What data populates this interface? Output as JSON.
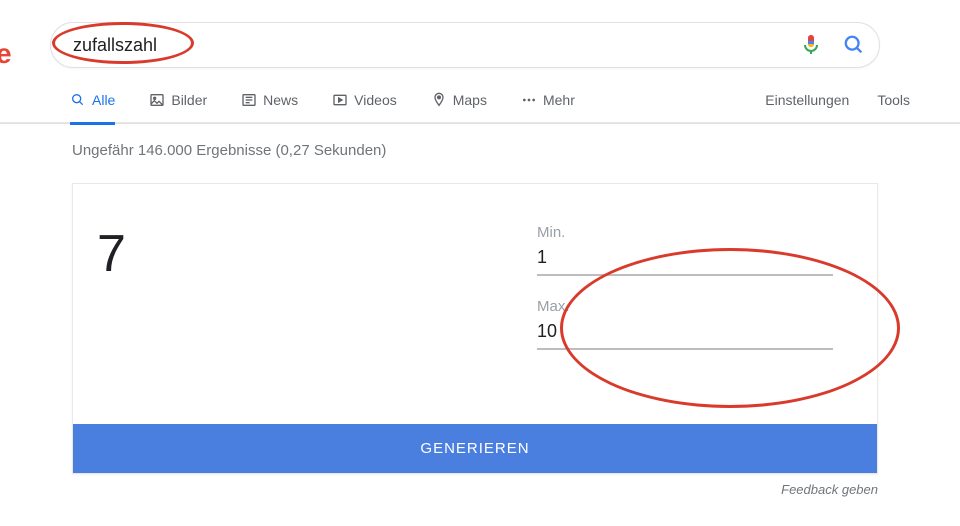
{
  "logo_fragment": "e",
  "search": {
    "query": "zufallszahl"
  },
  "tabs": {
    "all": "Alle",
    "images": "Bilder",
    "news": "News",
    "videos": "Videos",
    "maps": "Maps",
    "more": "Mehr",
    "settings": "Einstellungen",
    "tools": "Tools"
  },
  "result_stats": "Ungefähr 146.000 Ergebnisse (0,27 Sekunden)",
  "rng": {
    "result": "7",
    "min_label": "Min.",
    "min_value": "1",
    "max_label": "Max.",
    "max_value": "10",
    "button": "GENERIEREN"
  },
  "feedback": "Feedback geben"
}
